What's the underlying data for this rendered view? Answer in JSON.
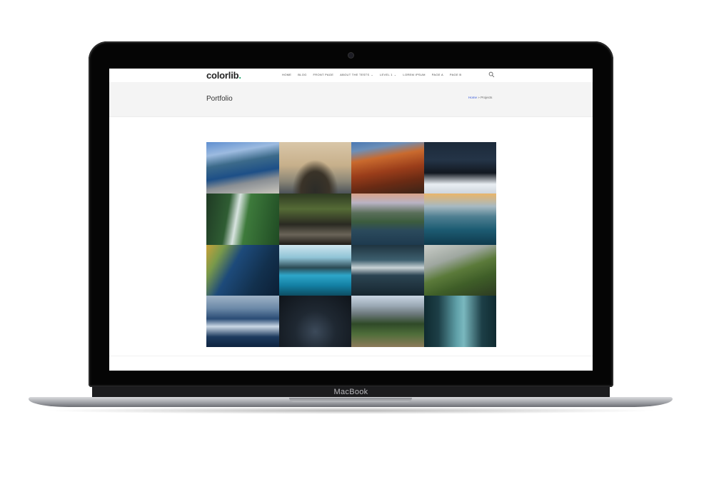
{
  "device": {
    "label": "MacBook"
  },
  "site": {
    "logo_text": "colorlib",
    "logo_dot": ".",
    "nav": [
      {
        "label": "HOME",
        "dropdown": false
      },
      {
        "label": "BLOG",
        "dropdown": false
      },
      {
        "label": "FRONT PAGE",
        "dropdown": false
      },
      {
        "label": "ABOUT THE TESTS",
        "dropdown": true
      },
      {
        "label": "LEVEL 1",
        "dropdown": true
      },
      {
        "label": "LOREM IPSUM",
        "dropdown": false
      },
      {
        "label": "PAGE A",
        "dropdown": false
      },
      {
        "label": "PAGE B",
        "dropdown": false
      }
    ],
    "page_title": "Portfolio",
    "breadcrumb": {
      "home": "Home",
      "separator": "»",
      "current": "Projects"
    }
  },
  "gallery": [
    {
      "name": "fjord-cliff-photo",
      "bg": "linear-gradient(170deg,#5f8fd0 0%,#9dbbe0 22%,#3c6a8a 40%,#1d4f87 60%,#8a8f94 75%,#c9c6bd 100%)"
    },
    {
      "name": "hooded-person-sunset-photo",
      "bg": "radial-gradient(ellipse at 50% 95%,#2c2c28 0%,#3a3328 28%,rgba(0,0,0,0) 45%),linear-gradient(#d9c6a8 0%,#c7b08b 45%,#8d8878 75%,#4c5259 100%)"
    },
    {
      "name": "red-rock-canyon-photo",
      "bg": "linear-gradient(170deg,#4a78b3 0%,#6c8fb8 15%,#c96a2e 32%,#9a3d1a 55%,#6b2b14 75%,#3b2418 100%)"
    },
    {
      "name": "snowy-cabin-forest-photo",
      "bg": "linear-gradient(#1c2a3a 0%,#243447 35%,#121820 60%,#e9eef3 82%,#cfd6dd 100%)"
    },
    {
      "name": "green-waterfall-photo",
      "bg": "linear-gradient(100deg,#1f3a24 0%,#2f5d33 30%,#d8e4e0 42%,#3d7a3b 55%,#1f4a23 100%)"
    },
    {
      "name": "bridge-walker-photo",
      "bg": "linear-gradient(#2e3a22 0%,#556b36 30%,#2a2a22 60%,#6a6458 80%,#1d1a16 100%)"
    },
    {
      "name": "mountain-lake-photo",
      "bg": "linear-gradient(#d8a38a 0%,#b9b3c4 18%,#5a6f5a 38%,#3c5c3e 55%,#2b4a5c 72%,#1e3a4f 100%)"
    },
    {
      "name": "ocean-wave-sunset-photo",
      "bg": "linear-gradient(#e9b56a 0%,#a7b9c2 25%,#4f7f91 45%,#1d5c73 70%,#0f3a4d 100%)"
    },
    {
      "name": "aerial-earth-photo",
      "bg": "linear-gradient(120deg,#c9a23a 0%,#7a9a4a 18%,#1d4a7a 38%,#12304d 70%,#0c1f35 100%)"
    },
    {
      "name": "canoe-lake-photo",
      "bg": "linear-gradient(#cfe6ef 0%,#8fc3d6 25%,#2b4a54 45%,#2ea6c9 60%,#137fa3 80%,#0d4d63 100%)"
    },
    {
      "name": "storm-clouds-photo",
      "bg": "linear-gradient(#1f3440 0%,#3d5f6e 30%,#c9d3d6 45%,#2c4452 60%,#16262f 100%)"
    },
    {
      "name": "green-hills-coast-photo",
      "bg": "linear-gradient(160deg,#c9cdc8 0%,#9fa7a0 30%,#5b7a3a 50%,#3f5e28 70%,#2d3b22 100%)"
    },
    {
      "name": "blue-wave-photo",
      "bg": "linear-gradient(#9fb3c7 0%,#6b88a7 25%,#2a4c75 45%,#cbd8e6 60%,#1d3a5e 80%,#0f2440 100%)"
    },
    {
      "name": "night-hiker-photo",
      "bg": "radial-gradient(ellipse at 50% 70%,#3c4a5a 0%,#1f2832 40%,#0f141a 100%)"
    },
    {
      "name": "yosemite-valley-photo",
      "bg": "linear-gradient(#c9d6e3 0%,#9aa8b4 20%,#6e7a7e 35%,#2f4a28 55%,#4f6e3a 75%,#8c7a5a 100%)"
    },
    {
      "name": "escalator-station-photo",
      "bg": "linear-gradient(90deg,#0f2a30 0%,#1d3f47 20%,#5fa0a8 45%,#7ab8bf 55%,#1d3f47 80%,#0f2a30 100%)"
    }
  ]
}
